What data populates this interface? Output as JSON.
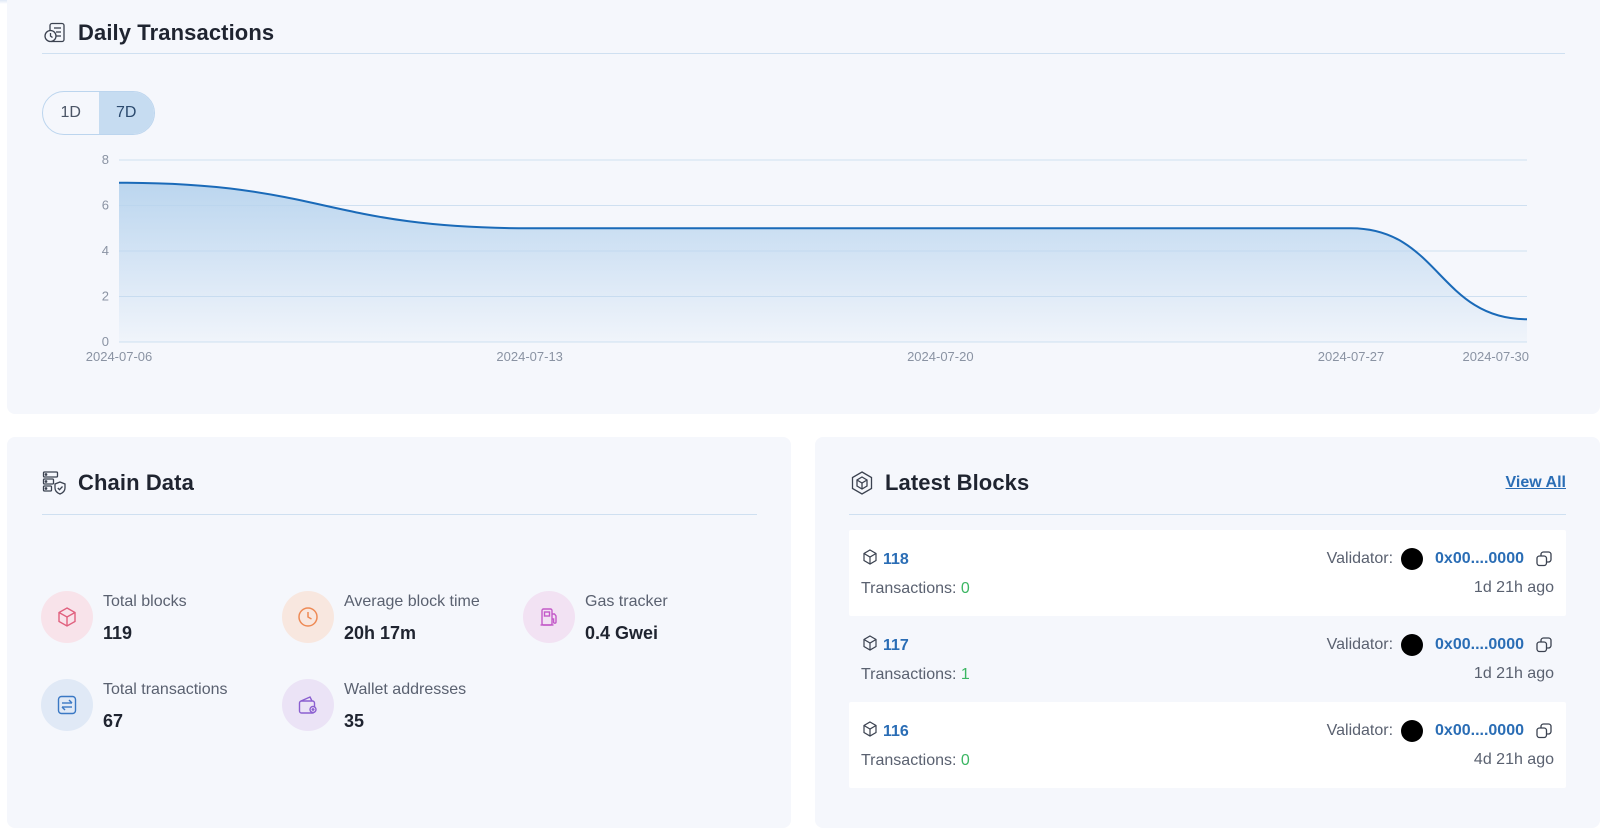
{
  "daily_transactions": {
    "title": "Daily Transactions",
    "range_options": [
      "1D",
      "7D"
    ],
    "selected_range": "7D"
  },
  "chart_data": {
    "type": "area",
    "x": [
      "2024-07-06",
      "2024-07-13",
      "2024-07-20",
      "2024-07-27",
      "2024-07-30"
    ],
    "series": [
      {
        "values": [
          7,
          5,
          5,
          5,
          1
        ]
      }
    ],
    "yticks": [
      0,
      2,
      4,
      6,
      8
    ],
    "ylim": [
      0,
      8
    ],
    "grid": true,
    "title": "",
    "xlabel": "",
    "ylabel": "",
    "line_color": "#1a6ab8",
    "fill_color": "#b8d4ee"
  },
  "chain_data": {
    "title": "Chain Data",
    "stats": [
      {
        "label": "Total blocks",
        "value": "119",
        "icon": "cube-icon",
        "bg": "#f8e3ea",
        "color": "#e0607e"
      },
      {
        "label": "Average block time",
        "value": "20h 17m",
        "icon": "clock-icon",
        "bg": "#f8e7df",
        "color": "#ee8a55"
      },
      {
        "label": "Gas tracker",
        "value": "0.4 Gwei",
        "icon": "gas-pump-icon",
        "bg": "#f2e2f3",
        "color": "#c35ac8"
      },
      {
        "label": "Total transactions",
        "value": "67",
        "icon": "transfer-icon",
        "bg": "#e0e9f6",
        "color": "#3a78c4"
      },
      {
        "label": "Wallet addresses",
        "value": "35",
        "icon": "wallet-icon",
        "bg": "#ebe3f6",
        "color": "#8b5fd0"
      }
    ]
  },
  "latest_blocks": {
    "title": "Latest Blocks",
    "view_all_label": "View All",
    "validator_label": "Validator:",
    "transactions_label": "Transactions:",
    "blocks": [
      {
        "number": "118",
        "transactions": "0",
        "validator": "0x00....0000",
        "age": "1d 21h ago"
      },
      {
        "number": "117",
        "transactions": "1",
        "validator": "0x00....0000",
        "age": "1d 21h ago"
      },
      {
        "number": "116",
        "transactions": "0",
        "validator": "0x00....0000",
        "age": "4d 21h ago"
      }
    ]
  }
}
